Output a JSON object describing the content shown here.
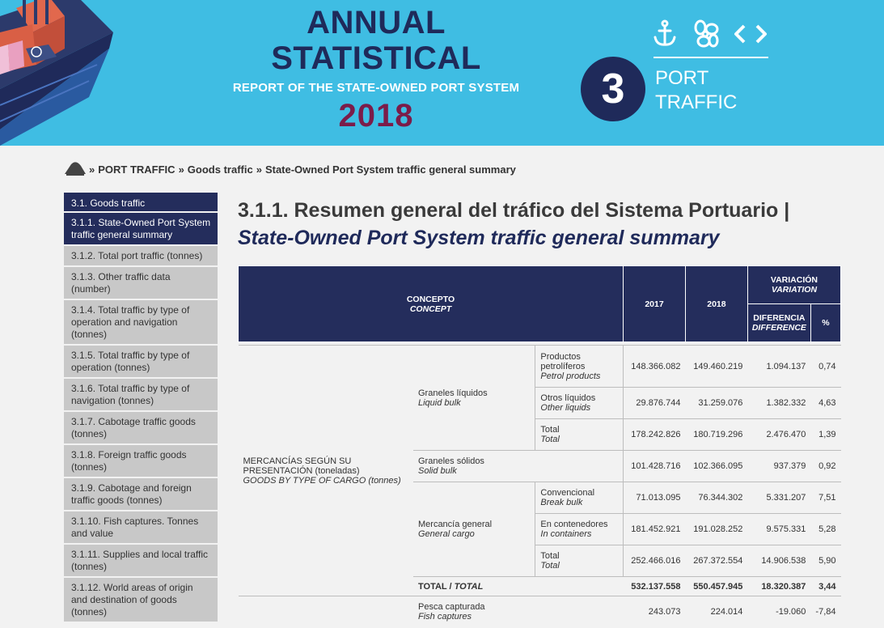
{
  "header": {
    "title_line1": "ANNUAL",
    "title_line2": "STATISTICAL",
    "subtitle": "REPORT OF THE STATE-OWNED PORT SYSTEM",
    "year": "2018",
    "chapter_number": "3",
    "chapter_name_line1": "PORT",
    "chapter_name_line2": "TRAFFIC",
    "icons": [
      "anchor-icon",
      "propeller-icon",
      "code-brackets-icon"
    ],
    "colors": {
      "banner": "#3fbde3",
      "navy": "#1f2a5a",
      "year": "#7b1c4a"
    }
  },
  "breadcrumb": {
    "sep1": "»",
    "item1": "PORT TRAFFIC",
    "sep2": "»",
    "item2": "Goods traffic",
    "sep3": "»",
    "item3": "State-Owned Port System traffic general summary"
  },
  "sidebar": {
    "section": "3.1. Goods traffic",
    "items": [
      "3.1.1. State-Owned Port System traffic general summary",
      "3.1.2. Total port traffic (tonnes)",
      "3.1.3. Other traffic data (number)",
      "3.1.4. Total traffic by type of operation and navigation (tonnes)",
      "3.1.5. Total traffic by type of operation (tonnes)",
      "3.1.6. Total traffic by type of navigation (tonnes)",
      "3.1.7. Cabotage traffic goods (tonnes)",
      "3.1.8. Foreign traffic goods (tonnes)",
      "3.1.9. Cabotage and foreign traffic goods (tonnes)",
      "3.1.10. Fish captures. Tonnes and value",
      "3.1.11. Supplies and local traffic (tonnes)",
      "3.1.12. World areas of origin and destination of goods (tonnes)"
    ]
  },
  "main": {
    "title_es": "3.1.1. Resumen general del tráfico del Sistema Portuario |",
    "title_en": "State-Owned Port System traffic general summary"
  },
  "table": {
    "head": {
      "concept_es": "CONCEPTO",
      "concept_en": "CONCEPT",
      "y2017": "2017",
      "y2018": "2018",
      "variation_es": "VARIACIÓN",
      "variation_en": "VARIATION",
      "difference_es": "DIFERENCIA",
      "difference_en": "DIFFERENCE",
      "pct": "%"
    },
    "group_es": "MERCANCÍAS SEGÚN SU PRESENTACIÓN (toneladas)",
    "group_en": "GOODS BY TYPE OF CARGO (tonnes)",
    "liquid_es": "Graneles líquidos",
    "liquid_en": "Liquid bulk",
    "solid_es": "Graneles sólidos",
    "solid_en": "Solid bulk",
    "general_es": "Mercancía general",
    "general_en": "General cargo",
    "rows": {
      "petrol": {
        "es": "Productos petrolíferos",
        "en": "Petrol products",
        "v2017": "148.366.082",
        "v2018": "149.460.219",
        "diff": "1.094.137",
        "pct": "0,74"
      },
      "otherliq": {
        "es": "Otros líquidos",
        "en": "Other liquids",
        "v2017": "29.876.744",
        "v2018": "31.259.076",
        "diff": "1.382.332",
        "pct": "4,63"
      },
      "liqtotal": {
        "es": "Total",
        "en": "Total",
        "v2017": "178.242.826",
        "v2018": "180.719.296",
        "diff": "2.476.470",
        "pct": "1,39"
      },
      "solid": {
        "v2017": "101.428.716",
        "v2018": "102.366.095",
        "diff": "937.379",
        "pct": "0,92"
      },
      "conv": {
        "es": "Convencional",
        "en": "Break bulk",
        "v2017": "71.013.095",
        "v2018": "76.344.302",
        "diff": "5.331.207",
        "pct": "7,51"
      },
      "cont": {
        "es": "En contenedores",
        "en": "In containers",
        "v2017": "181.452.921",
        "v2018": "191.028.252",
        "diff": "9.575.331",
        "pct": "5,28"
      },
      "gentotal": {
        "es": "Total",
        "en": "Total",
        "v2017": "252.466.016",
        "v2018": "267.372.554",
        "diff": "14.906.538",
        "pct": "5,90"
      },
      "total": {
        "es": "TOTAL",
        "sep": "/",
        "en": "TOTAL",
        "v2017": "532.137.558",
        "v2018": "550.457.945",
        "diff": "18.320.387",
        "pct": "3,44"
      },
      "fish": {
        "es": "Pesca capturada",
        "en": "Fish captures",
        "v2017": "243.073",
        "v2018": "224.014",
        "diff": "-19.060",
        "pct": "-7,84"
      }
    }
  }
}
